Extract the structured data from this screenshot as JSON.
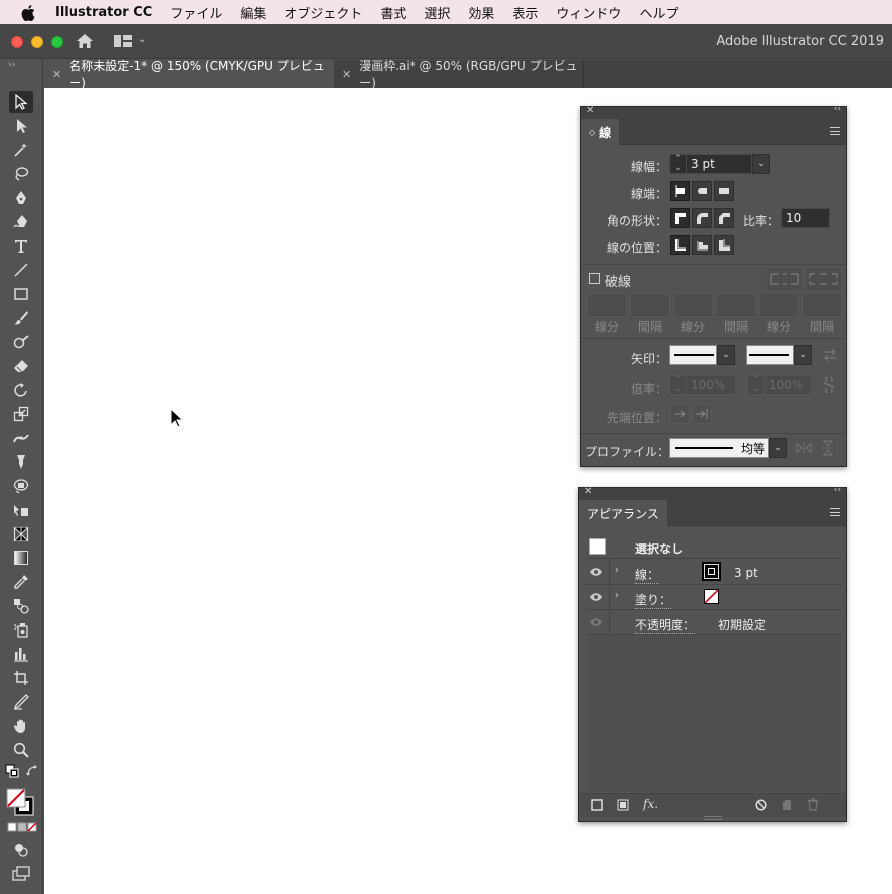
{
  "menubar": {
    "app_name": "Illustrator CC",
    "items": [
      "ファイル",
      "編集",
      "オブジェクト",
      "書式",
      "選択",
      "効果",
      "表示",
      "ウィンドウ",
      "ヘルプ"
    ]
  },
  "appbar": {
    "title": "Adobe Illustrator CC 2019"
  },
  "tabs": [
    {
      "label": "名称未設定-1* @ 150% (CMYK/GPU プレビュー)",
      "active": true
    },
    {
      "label": "漫画枠.ai* @ 50% (RGB/GPU プレビュー)",
      "active": false
    }
  ],
  "stroke_panel": {
    "tab": "線",
    "weight_label": "線幅：",
    "weight_value": "3 pt",
    "cap_label": "線端：",
    "corner_label": "角の形状：",
    "limit_label": "比率：",
    "limit_value": "10",
    "align_label": "線の位置：",
    "dashed_label": "破線",
    "dash_cols": [
      "線分",
      "間隔",
      "線分",
      "間隔",
      "線分",
      "間隔"
    ],
    "arrow_label": "矢印：",
    "scale_label": "倍率：",
    "scale_value_1": "100%",
    "scale_value_2": "100%",
    "align_arrow_label": "先端位置：",
    "profile_label": "プロファイル：",
    "profile_value": "均等"
  },
  "appearance_panel": {
    "tab": "アピアランス",
    "header": "選択なし",
    "rows": [
      {
        "label": "線：",
        "value": "3 pt"
      },
      {
        "label": "塗り：",
        "value": ""
      },
      {
        "label": "不透明度：",
        "value": "初期設定"
      }
    ],
    "fx_label": "fx."
  },
  "colors": {
    "accent": "#2d2d2d",
    "fill_none_red": "#d0021b"
  }
}
